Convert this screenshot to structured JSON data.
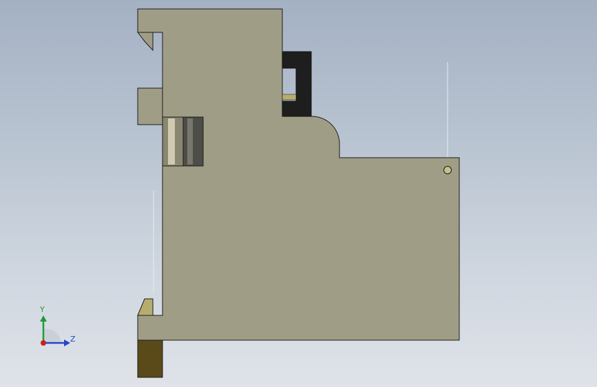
{
  "viewport": {
    "background_top": "#a4b1c3",
    "background_bottom": "#dfe3e9"
  },
  "part": {
    "body_color": "#a09d87",
    "edge_color": "#1a1a1a",
    "connector_color": "#1e1e1e",
    "brass_color": "#b7ad6e",
    "foot_color": "#5a4a1a",
    "cylinder_colors": [
      "#8a8670",
      "#cfcab0",
      "#4a4a44"
    ]
  },
  "triad": {
    "y_label": "Y",
    "z_label": "Z",
    "y_color": "#1f9a3a",
    "z_color": "#2646c8",
    "x_color": "#cc2020"
  }
}
